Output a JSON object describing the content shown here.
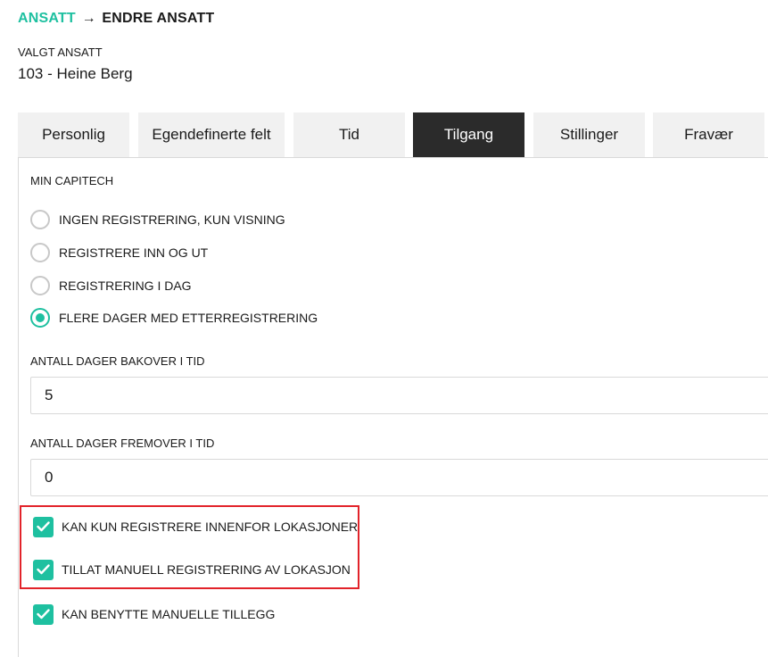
{
  "breadcrumb": {
    "parent": "ANSATT",
    "separator": "→",
    "current": "ENDRE ANSATT"
  },
  "selected_employee": {
    "label": "VALGT ANSATT",
    "value": "103 - Heine Berg"
  },
  "tabs": [
    {
      "label": "Personlig",
      "active": false
    },
    {
      "label": "Egendefinerte felt",
      "active": false
    },
    {
      "label": "Tid",
      "active": false
    },
    {
      "label": "Tilgang",
      "active": true
    },
    {
      "label": "Stillinger",
      "active": false
    },
    {
      "label": "Fravær",
      "active": false
    }
  ],
  "min_capitech": {
    "title": "MIN CAPITECH",
    "options": [
      {
        "label": "INGEN REGISTRERING, KUN VISNING",
        "selected": false
      },
      {
        "label": "REGISTRERE INN OG UT",
        "selected": false
      },
      {
        "label": "REGISTRERING I DAG",
        "selected": false
      },
      {
        "label": "FLERE DAGER MED ETTERREGISTRERING",
        "selected": true
      }
    ]
  },
  "days_back": {
    "label": "ANTALL DAGER BAKOVER I TID",
    "value": "5"
  },
  "days_forward": {
    "label": "ANTALL DAGER FREMOVER I TID",
    "value": "0"
  },
  "checkboxes": [
    {
      "label": "KAN KUN REGISTRERE INNENFOR LOKASJONER",
      "checked": true
    },
    {
      "label": "TILLAT MANUELL REGISTRERING AV LOKASJON",
      "checked": true
    },
    {
      "label": "KAN BENYTTE MANUELLE TILLEGG",
      "checked": true
    }
  ],
  "colors": {
    "accent": "#1ec0a0",
    "active_tab": "#2b2b2b",
    "highlight": "#e2232a"
  }
}
